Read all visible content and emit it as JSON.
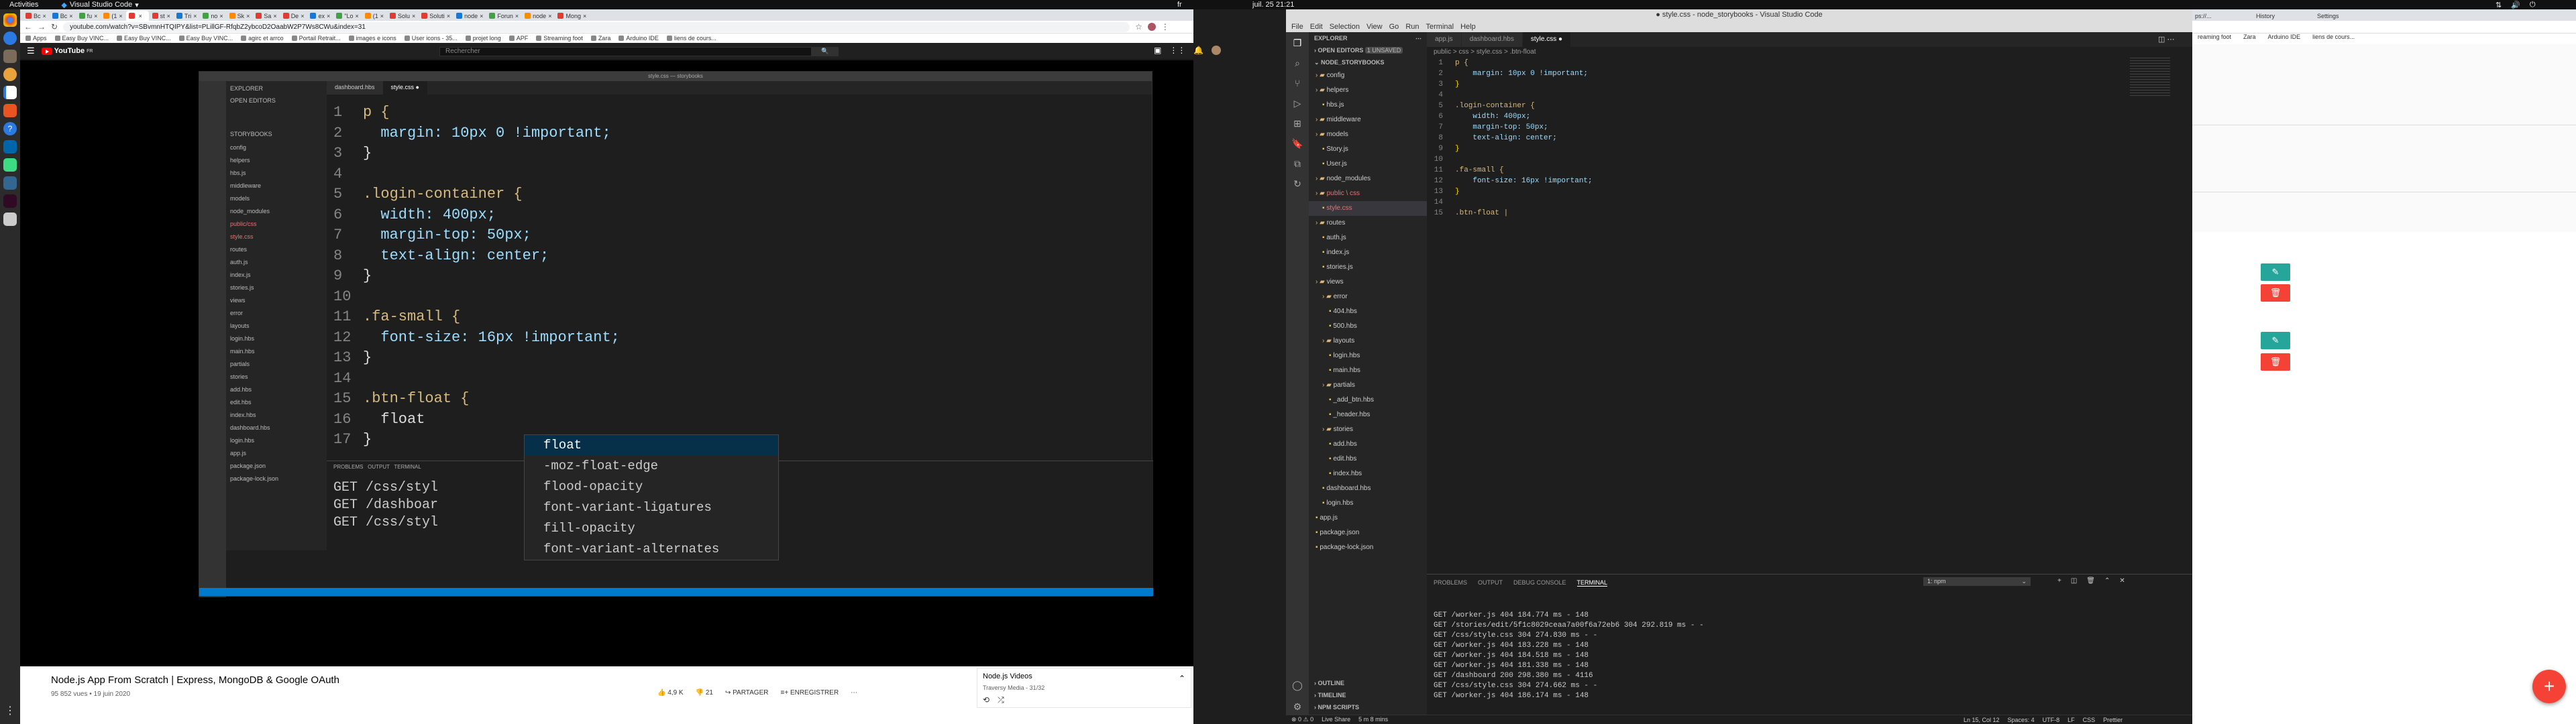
{
  "topbar": {
    "activities": "Activities",
    "app": "Visual Studio Code",
    "clock": "juil. 25  21:21",
    "lang": "fr"
  },
  "chrome": {
    "tabs": [
      "Bc",
      "Bc",
      "fu",
      "(1",
      "",
      "st",
      "Tri",
      "no",
      "Sk",
      "Sa",
      "De",
      "ex",
      "\"Lo",
      "(1",
      "Solu",
      "Soluti",
      "node",
      "Forun",
      "node",
      "Mong"
    ],
    "url": "youtube.com/watch?v=SBvmnHTQIPY&list=PLillGF-RfqbZ2ybcoD2OaabW2P7Ws8CWu&index=31",
    "bookmarks": [
      "Apps",
      "Easy Buy VINC...",
      "Easy Buy VINC...",
      "Easy Buy VINC...",
      "agirc et arrco",
      "Portail Retrait...",
      "images e icons",
      "User icons - 35...",
      "projet long",
      "APF",
      "Streaming foot",
      "Zara",
      "Arduino IDE",
      "liens de cours..."
    ]
  },
  "youtube": {
    "logo": "YouTube",
    "country": "FR",
    "search_placeholder": "Rechercher",
    "video_title": "Node.js App From Scratch | Express, MongoDB & Google OAuth",
    "views": "95 852 vues • 19 juin 2020",
    "likes": "4,9 K",
    "dislikes": "21",
    "share": "PARTAGER",
    "save": "ENREGISTRER",
    "playlist_title": "Node.js Videos",
    "playlist_sub": "Traversy Media - 31/32"
  },
  "video_editor": {
    "lines": [
      {
        "n": "1",
        "t": "p {"
      },
      {
        "n": "2",
        "t": "  margin: 10px 0 !important;"
      },
      {
        "n": "3",
        "t": "}"
      },
      {
        "n": "4",
        "t": ""
      },
      {
        "n": "5",
        "t": ".login-container {"
      },
      {
        "n": "6",
        "t": "  width: 400px;"
      },
      {
        "n": "7",
        "t": "  margin-top: 50px;"
      },
      {
        "n": "8",
        "t": "  text-align: center;"
      },
      {
        "n": "9",
        "t": "}"
      },
      {
        "n": "10",
        "t": ""
      },
      {
        "n": "11",
        "t": ".fa-small {"
      },
      {
        "n": "12",
        "t": "  font-size: 16px !important;"
      },
      {
        "n": "13",
        "t": "}"
      },
      {
        "n": "14",
        "t": ""
      },
      {
        "n": "15",
        "t": ".btn-float {"
      },
      {
        "n": "16",
        "t": "  float"
      },
      {
        "n": "17",
        "t": "}"
      }
    ],
    "suggestions": [
      "float",
      "-moz-float-edge",
      "flood-opacity",
      "font-variant-ligatures",
      "fill-opacity",
      "font-variant-alternates"
    ],
    "terminal": [
      "GET /css/styl",
      "GET /dashboar",
      "GET /css/styl"
    ]
  },
  "vscode": {
    "title": "● style.css - node_storybooks - Visual Studio Code",
    "menu": [
      "File",
      "Edit",
      "Selection",
      "View",
      "Go",
      "Run",
      "Terminal",
      "Help"
    ],
    "explorer": "EXPLORER",
    "open_editors": "OPEN EDITORS",
    "unsaved": "1 UNSAVED",
    "project": "NODE_STORYBOOKS",
    "tree": [
      {
        "l": "config",
        "d": 1,
        "f": true
      },
      {
        "l": "helpers",
        "d": 1,
        "f": true
      },
      {
        "l": "hbs.js",
        "d": 2
      },
      {
        "l": "middleware",
        "d": 1,
        "f": true
      },
      {
        "l": "models",
        "d": 1,
        "f": true
      },
      {
        "l": "Story.js",
        "d": 2
      },
      {
        "l": "User.js",
        "d": 2
      },
      {
        "l": "node_modules",
        "d": 1,
        "f": true
      },
      {
        "l": "public \\ css",
        "d": 1,
        "f": true,
        "red": true
      },
      {
        "l": "style.css",
        "d": 2,
        "sel": true,
        "red": true
      },
      {
        "l": "routes",
        "d": 1,
        "f": true
      },
      {
        "l": "auth.js",
        "d": 2
      },
      {
        "l": "index.js",
        "d": 2
      },
      {
        "l": "stories.js",
        "d": 2
      },
      {
        "l": "views",
        "d": 1,
        "f": true
      },
      {
        "l": "error",
        "d": 2,
        "f": true
      },
      {
        "l": "404.hbs",
        "d": 3
      },
      {
        "l": "500.hbs",
        "d": 3
      },
      {
        "l": "layouts",
        "d": 2,
        "f": true
      },
      {
        "l": "login.hbs",
        "d": 3
      },
      {
        "l": "main.hbs",
        "d": 3
      },
      {
        "l": "partials",
        "d": 2,
        "f": true
      },
      {
        "l": "_add_btn.hbs",
        "d": 3
      },
      {
        "l": "_header.hbs",
        "d": 3
      },
      {
        "l": "stories",
        "d": 2,
        "f": true
      },
      {
        "l": "add.hbs",
        "d": 3
      },
      {
        "l": "edit.hbs",
        "d": 3
      },
      {
        "l": "index.hbs",
        "d": 3
      },
      {
        "l": "dashboard.hbs",
        "d": 2
      },
      {
        "l": "login.hbs",
        "d": 2
      },
      {
        "l": "app.js",
        "d": 1
      },
      {
        "l": "package.json",
        "d": 1
      },
      {
        "l": "package-lock.json",
        "d": 1
      }
    ],
    "outline": "OUTLINE",
    "timeline": "TIMELINE",
    "npm": "NPM SCRIPTS",
    "tabs": [
      "app.js",
      "dashboard.hbs",
      "style.css"
    ],
    "breadcrumb": "public > css > style.css > .btn-float",
    "code": [
      {
        "n": "1",
        "t": "p {"
      },
      {
        "n": "2",
        "t": "    margin: 10px 0 !important;"
      },
      {
        "n": "3",
        "t": "}"
      },
      {
        "n": "4",
        "t": ""
      },
      {
        "n": "5",
        "t": ".login-container {"
      },
      {
        "n": "6",
        "t": "    width: 400px;"
      },
      {
        "n": "7",
        "t": "    margin-top: 50px;"
      },
      {
        "n": "8",
        "t": "    text-align: center;"
      },
      {
        "n": "9",
        "t": "}"
      },
      {
        "n": "10",
        "t": ""
      },
      {
        "n": "11",
        "t": ".fa-small {"
      },
      {
        "n": "12",
        "t": "    font-size: 16px !important;"
      },
      {
        "n": "13",
        "t": "}"
      },
      {
        "n": "14",
        "t": ""
      },
      {
        "n": "15",
        "t": ".btn-float |"
      }
    ],
    "panel_tabs": [
      "PROBLEMS",
      "OUTPUT",
      "DEBUG CONSOLE",
      "TERMINAL"
    ],
    "terminal_select": "1: npm",
    "terminal": [
      "GET /worker.js 404 184.774 ms - 148",
      "GET /stories/edit/5f1c8029ceaa7a00f6a72eb6 304 292.819 ms - -",
      "GET /css/style.css 304 274.830 ms - -",
      "GET /worker.js 404 183.228 ms - 148",
      "GET /worker.js 404 184.518 ms - 148",
      "GET /worker.js 404 181.338 ms - 148",
      "GET /dashboard 200 298.380 ms - 4116",
      "GET /css/style.css 304 274.662 ms - -",
      "GET /worker.js 404 186.174 ms - 148"
    ],
    "status_left": [
      "⊗ 0 ⚠ 0",
      "Live Share",
      "5 m 8 mins"
    ],
    "status_right": [
      "Ln 15, Col 12",
      "Spaces: 4",
      "UTF-8",
      "LF",
      "CSS",
      "Prettier"
    ]
  },
  "chrome2": {
    "tabs": [
      "ps://...",
      "History",
      "Settings"
    ],
    "bookmarks": [
      "reaming foot",
      "Zara",
      "Arduino IDE",
      "liens de cours..."
    ]
  }
}
